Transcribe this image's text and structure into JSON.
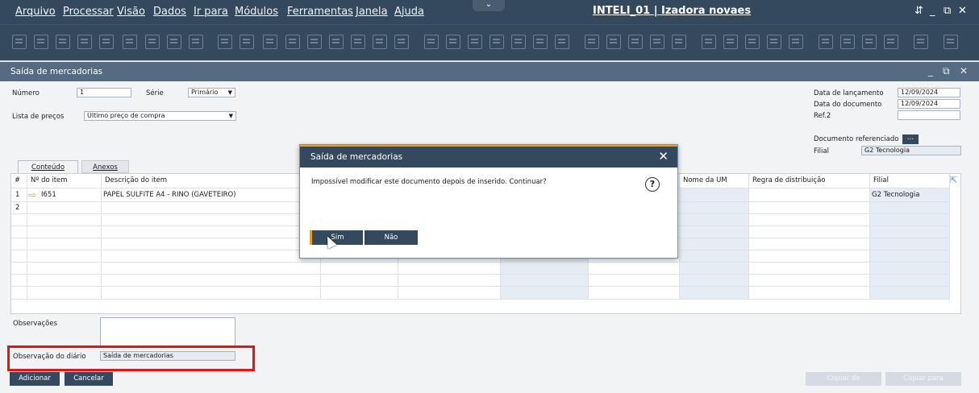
{
  "menu": [
    "Arquivo",
    "Processar",
    "Visão",
    "Dados",
    "Ir para",
    "Módulos",
    "Ferramentas",
    "Janela",
    "Ajuda"
  ],
  "company": "INTELI_01 | Izadora novaes",
  "window_controls": [
    "⇵",
    "_",
    "⧉",
    "✕"
  ],
  "document": {
    "title": "Saída de mercadorias",
    "controls": [
      "_",
      "⧉",
      "✕"
    ],
    "numero_label": "Número",
    "numero_value": "1",
    "serie_label": "Série",
    "serie_value": "Primário",
    "lista_label": "Lista de preços",
    "lista_value": "Último preço de compra",
    "data_lanc_label": "Data de lançamento",
    "data_lanc_value": "12/09/2024",
    "data_doc_label": "Data do documento",
    "data_doc_value": "12/09/2024",
    "ref2_label": "Ref.2",
    "ref2_value": "",
    "doc_ref_label": "Documento referenciado",
    "doc_ref_button": "...",
    "filial_label": "Filial",
    "filial_value": "G2 Tecnologia"
  },
  "tabs": [
    {
      "label": "Conteúdo",
      "active": true
    },
    {
      "label": "Anexos",
      "active": false
    }
  ],
  "grid": {
    "headers": [
      "#",
      "Nº do item",
      "Descrição do item",
      "Nome da UM",
      "Regra de distribuição",
      "Filial"
    ],
    "rows": [
      {
        "num": "1",
        "item": "I651",
        "desc": "PAPEL SULFITE A4 - RINO (GAVETEIRO)",
        "um": "",
        "regra": "",
        "filial": "G2 Tecnologia"
      },
      {
        "num": "2",
        "item": "",
        "desc": "",
        "um": "",
        "regra": "",
        "filial": ""
      }
    ]
  },
  "observacoes_label": "Observações",
  "observacoes_value": "",
  "obs_diario_label": "Observação do diário",
  "obs_diario_value": "Saída de mercadorias",
  "buttons": {
    "adicionar": "Adicionar",
    "cancelar": "Cancelar",
    "copiar_de": "Copiar de",
    "copiar_para": "Copiar para"
  },
  "dialog": {
    "title": "Saída de mercadorias",
    "close": "✕",
    "message": "Impossível modificar este documento depois de inserido. Continuar?",
    "help": "?",
    "yes": "Sim",
    "no": "Não"
  },
  "colors": {
    "header_bg": "#34495e",
    "accent": "#e7a020",
    "highlight": "#e01515"
  }
}
